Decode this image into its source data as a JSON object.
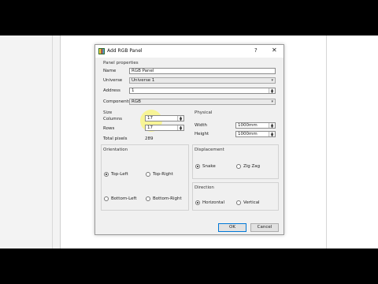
{
  "dialog": {
    "title": "Add RGB Panel",
    "help_glyph": "?",
    "close_glyph": "✕",
    "panel_properties": {
      "heading": "Panel properties",
      "name_label": "Name",
      "name_value": "RGB Panel",
      "universe_label": "Universe",
      "universe_value": "Universe 1",
      "address_label": "Address",
      "address_value": "1",
      "components_label": "Components",
      "components_value": "RGB"
    },
    "size": {
      "heading": "Size",
      "columns_label": "Columns",
      "columns_value": "17",
      "rows_label": "Rows",
      "rows_value": "17",
      "total_label": "Total pixels",
      "total_value": "289"
    },
    "physical": {
      "heading": "Physical",
      "width_label": "Width",
      "width_value": "1000mm",
      "height_label": "Height",
      "height_value": "1000mm"
    },
    "orientation": {
      "heading": "Orientation",
      "options": [
        "Top-Left",
        "Top-Right",
        "Bottom-Left",
        "Bottom-Right"
      ],
      "selected": "Top-Left"
    },
    "displacement": {
      "heading": "Displacement",
      "options": [
        "Snake",
        "Zig Zag"
      ],
      "selected": "Snake"
    },
    "direction": {
      "heading": "Direction",
      "options": [
        "Horizontal",
        "Vertical"
      ],
      "selected": "Horizontal"
    },
    "buttons": {
      "ok": "OK",
      "cancel": "Cancel"
    }
  },
  "icons": {
    "app": "qlc-app-icon",
    "dropdown": "chevron-down-icon",
    "spin": "spin-arrows-icon"
  },
  "colors": {
    "highlight": "#faf578",
    "default_button_border": "#0078d7"
  }
}
